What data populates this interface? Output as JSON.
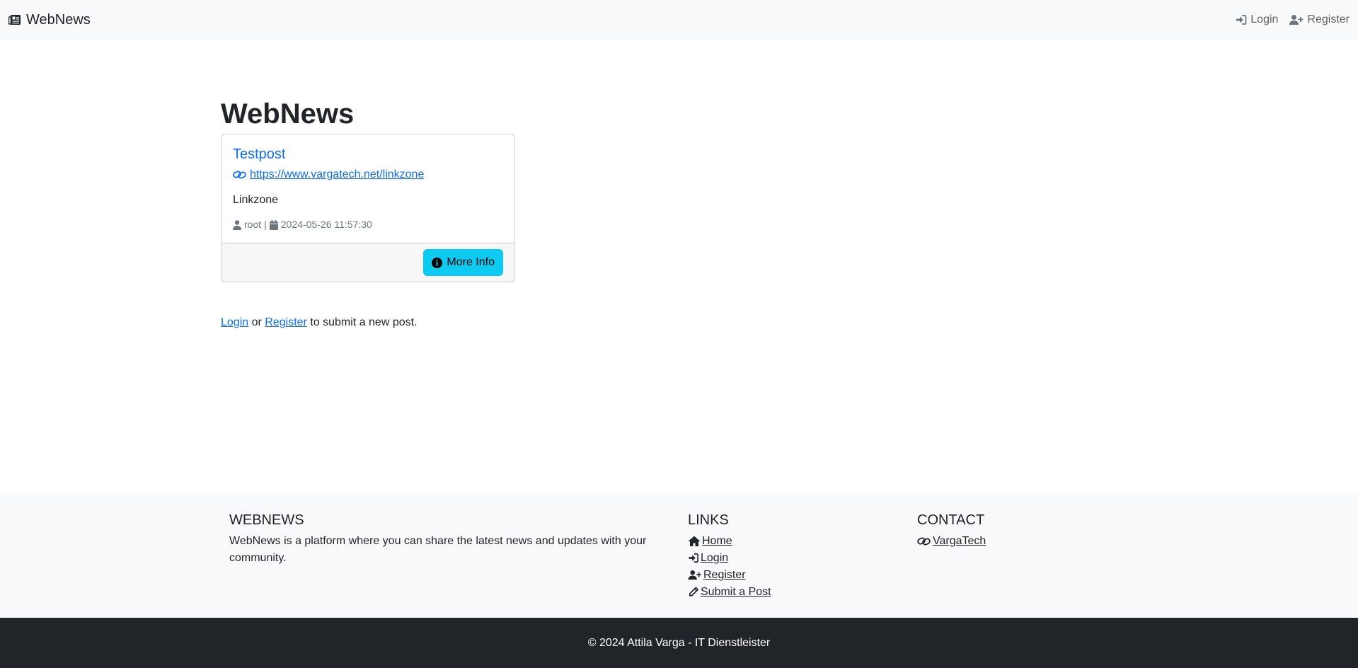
{
  "navbar": {
    "brand": "WebNews",
    "brand_icon": "newspaper-icon",
    "login_label": "Login",
    "register_label": "Register"
  },
  "main": {
    "title": "WebNews",
    "posts": [
      {
        "title": "Testpost",
        "url": "https://www.vargatech.net/linkzone",
        "description": "Linkzone",
        "author": "root",
        "separator": "|",
        "date": "2024-05-26 11:57:30",
        "button_label": "More Info"
      }
    ],
    "submit_login": "Login",
    "submit_or": "or",
    "submit_register": "Register",
    "submit_suffix": "to submit a new post."
  },
  "footer": {
    "about_title": "WEBNEWS",
    "about_text": "WebNews is a platform where you can share the latest news and updates with your community.",
    "links_title": "LINKS",
    "links": [
      {
        "label": "Home",
        "icon": "home-icon"
      },
      {
        "label": "Login",
        "icon": "login-icon"
      },
      {
        "label": "Register",
        "icon": "user-plus-icon"
      },
      {
        "label": "Submit a Post",
        "icon": "pencil-icon"
      }
    ],
    "contact_title": "CONTACT",
    "contact_link": "VargaTech",
    "copyright": "© 2024 Attila Varga - IT Dienstleister"
  },
  "colors": {
    "primary": "#0d6efd",
    "info": "#0dcaf0",
    "dark": "#212529",
    "light": "#f8f9fa"
  }
}
